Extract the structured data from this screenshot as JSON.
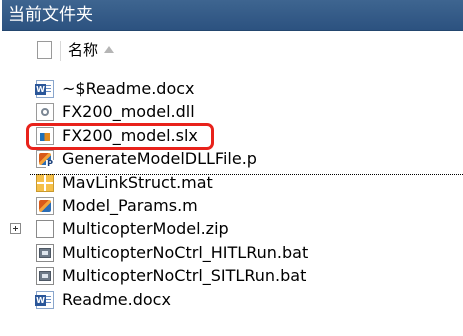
{
  "panel": {
    "title": "当前文件夹"
  },
  "header": {
    "name_column": "名称",
    "sort_icon": "sort-ascending-icon"
  },
  "files": [
    {
      "name": "~$Readme.docx",
      "icon": "word-document-icon",
      "expandable": false
    },
    {
      "name": "FX200_model.dll",
      "icon": "dll-file-icon",
      "expandable": false
    },
    {
      "name": "FX200_model.slx",
      "icon": "simulink-model-icon",
      "expandable": false,
      "highlighted": true
    },
    {
      "name": "GenerateModelDLLFile.p",
      "icon": "matlab-p-file-icon",
      "expandable": false,
      "selected": true
    },
    {
      "name": "MavLinkStruct.mat",
      "icon": "mat-file-icon",
      "expandable": false
    },
    {
      "name": "Model_Params.m",
      "icon": "matlab-script-icon",
      "expandable": false
    },
    {
      "name": "MulticopterModel.zip",
      "icon": "zip-file-icon",
      "expandable": true
    },
    {
      "name": "MulticopterNoCtrl_HITLRun.bat",
      "icon": "batch-file-icon",
      "expandable": false
    },
    {
      "name": "MulticopterNoCtrl_SITLRun.bat",
      "icon": "batch-file-icon",
      "expandable": false
    },
    {
      "name": "Readme.docx",
      "icon": "word-document-icon",
      "expandable": false
    }
  ],
  "colors": {
    "titlebar": "#2c5280",
    "highlight_box": "#e8221b"
  }
}
